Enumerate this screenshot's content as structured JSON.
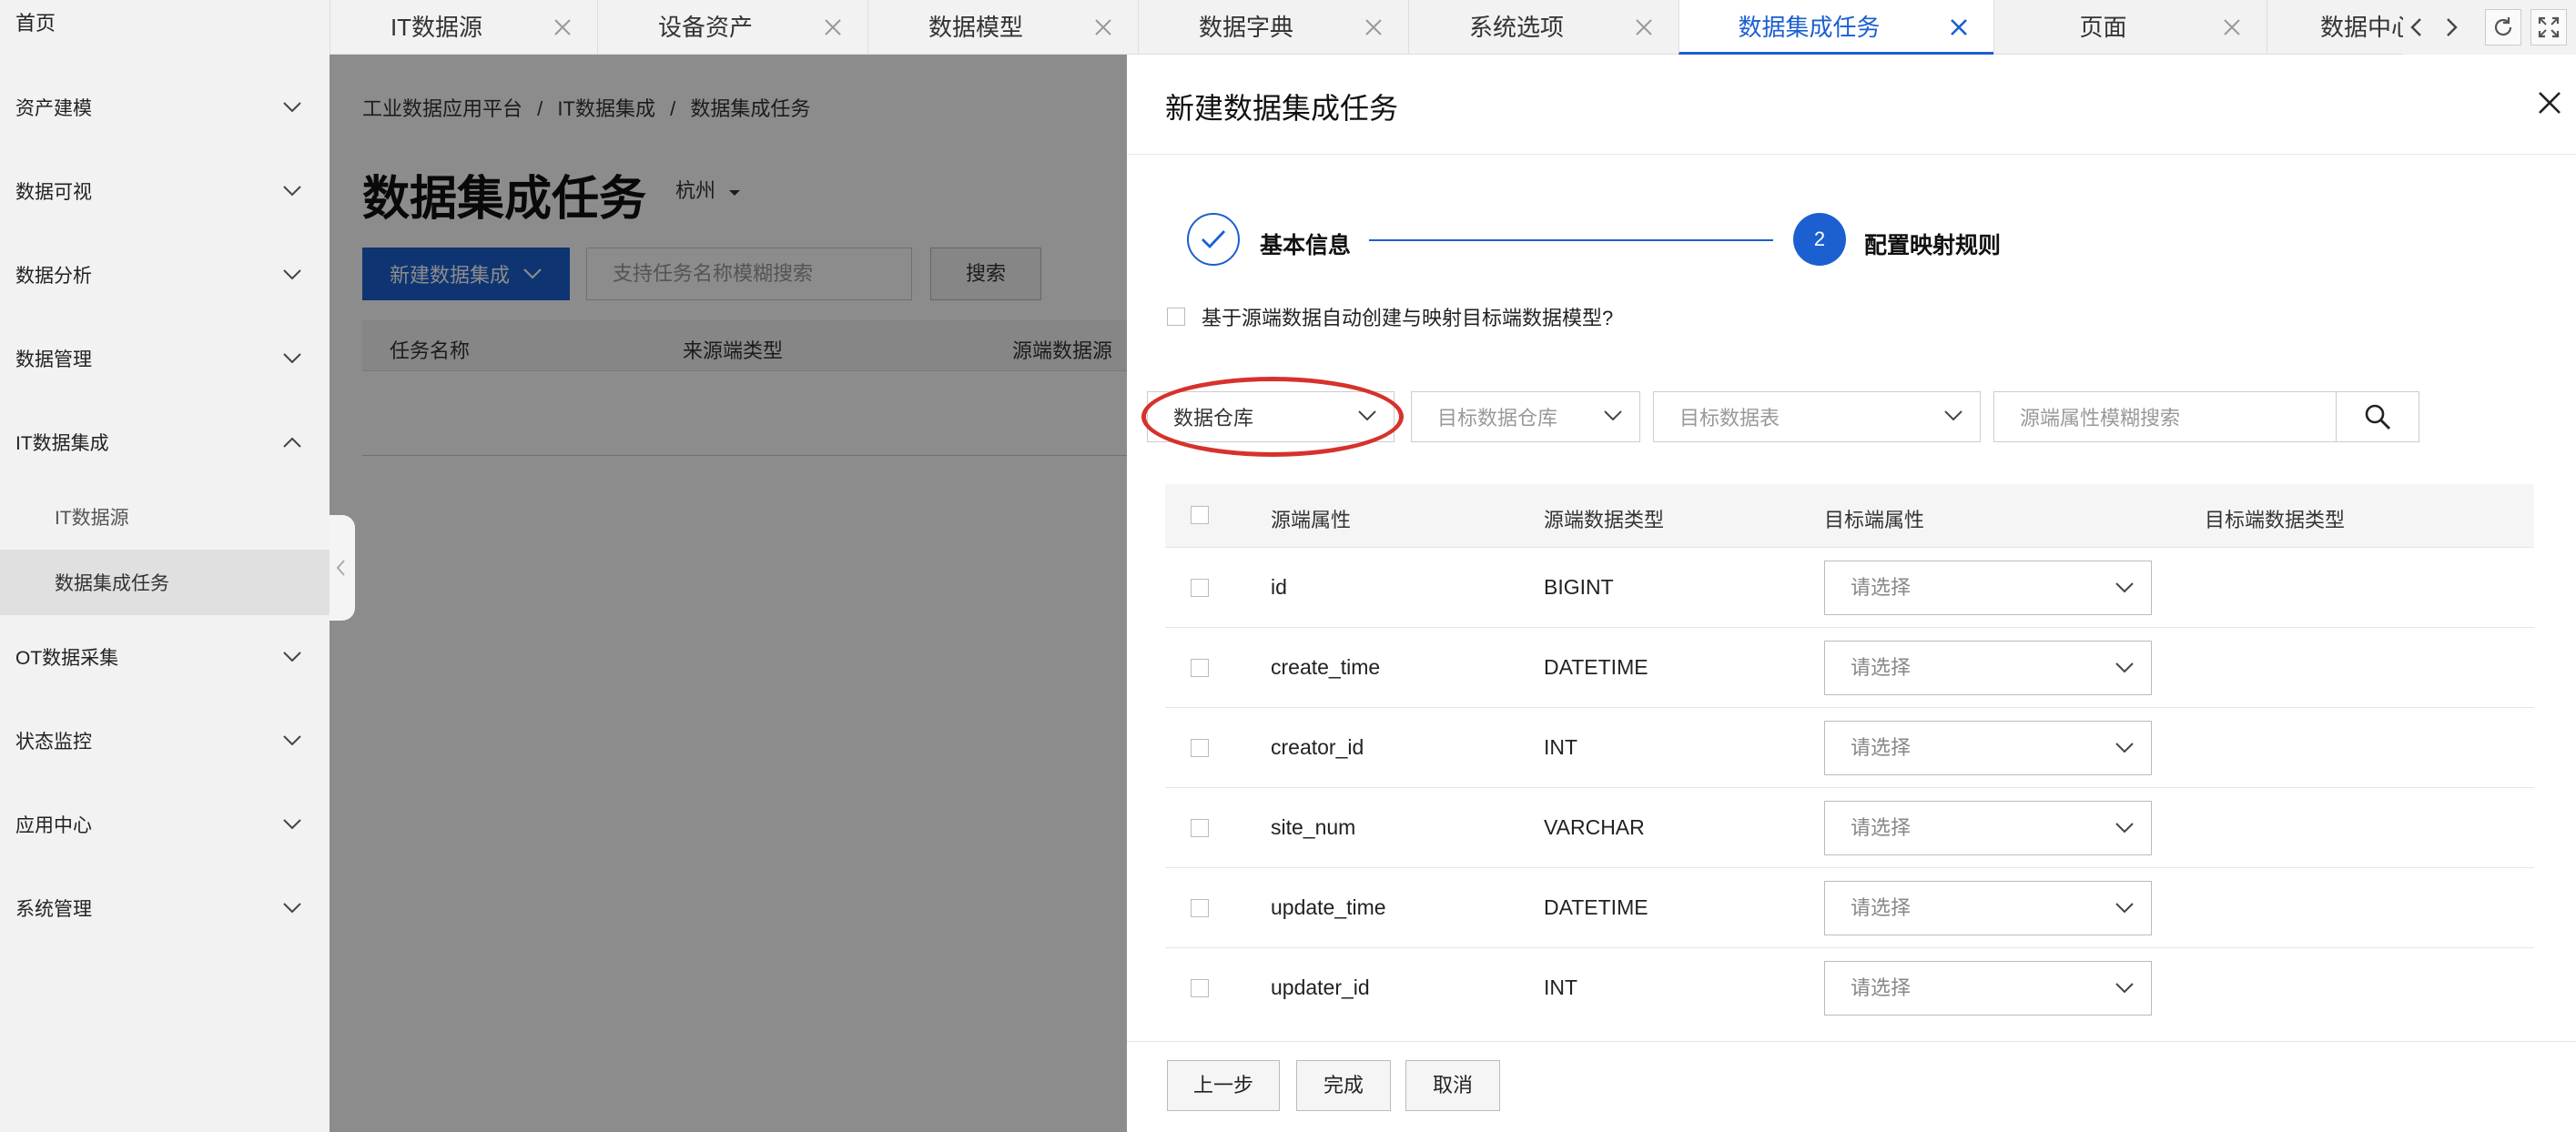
{
  "sidebar": {
    "home": "首页",
    "items": [
      {
        "label": "资产建模"
      },
      {
        "label": "数据可视"
      },
      {
        "label": "数据分析"
      },
      {
        "label": "数据管理"
      },
      {
        "label": "IT数据集成"
      },
      {
        "label": "OT数据采集"
      },
      {
        "label": "状态监控"
      },
      {
        "label": "应用中心"
      },
      {
        "label": "系统管理"
      }
    ],
    "subitems": [
      {
        "label": "IT数据源"
      },
      {
        "label": "数据集成任务"
      }
    ]
  },
  "tabs": [
    {
      "label": "IT数据源"
    },
    {
      "label": "设备资产"
    },
    {
      "label": "数据模型"
    },
    {
      "label": "数据字典"
    },
    {
      "label": "系统选项"
    },
    {
      "label": "数据集成任务"
    },
    {
      "label": "页面"
    },
    {
      "label": "数据中心"
    }
  ],
  "main": {
    "breadcrumb": [
      "工业数据应用平台",
      "/",
      "IT数据集成",
      "/",
      "数据集成任务"
    ],
    "title": "数据集成任务",
    "city": "杭州",
    "new_button": "新建数据集成",
    "search_placeholder": "支持任务名称模糊搜索",
    "search_button": "搜索",
    "columns": [
      "任务名称",
      "来源端类型",
      "源端数据源"
    ]
  },
  "drawer": {
    "title": "新建数据集成任务",
    "steps": [
      {
        "label": "基本信息"
      },
      {
        "number": "2",
        "label": "配置映射规则"
      }
    ],
    "auto_create_label": "基于源端数据自动创建与映射目标端数据模型?",
    "filters": {
      "source_type": "数据仓库",
      "target_warehouse": "目标数据仓库",
      "target_table": "目标数据表",
      "attr_search_placeholder": "源端属性模糊搜索"
    },
    "table": {
      "columns": [
        "源端属性",
        "源端数据类型",
        "目标端属性",
        "目标端数据类型"
      ],
      "select_placeholder": "请选择",
      "rows": [
        {
          "attr": "id",
          "type": "BIGINT"
        },
        {
          "attr": "create_time",
          "type": "DATETIME"
        },
        {
          "attr": "creator_id",
          "type": "INT"
        },
        {
          "attr": "site_num",
          "type": "VARCHAR"
        },
        {
          "attr": "update_time",
          "type": "DATETIME"
        },
        {
          "attr": "updater_id",
          "type": "INT"
        }
      ]
    },
    "footer": {
      "prev": "上一步",
      "finish": "完成",
      "cancel": "取消"
    }
  },
  "colors": {
    "primary": "#1b5fd0",
    "highlight": "#d6322b"
  }
}
